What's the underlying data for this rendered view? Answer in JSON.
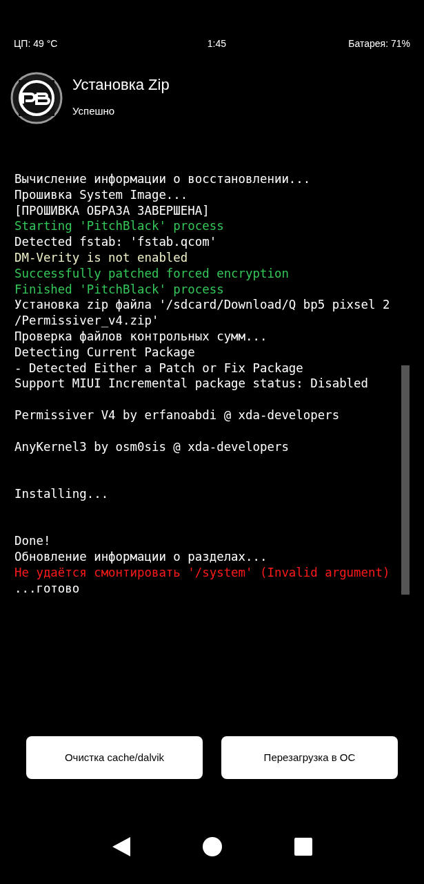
{
  "status_bar": {
    "cpu": "ЦП: 49 °C",
    "time": "1:45",
    "battery": "Батарея: 71%"
  },
  "header": {
    "title": "Установка Zip",
    "subtitle": "Успешно"
  },
  "log": [
    {
      "kind": "normal",
      "text": "Вычисление информации о восстановлении..."
    },
    {
      "kind": "normal",
      "text": "Прошивка System Image..."
    },
    {
      "kind": "normal",
      "text": "[ПРОШИВКА ОБРАЗА ЗАВЕРШЕНА]"
    },
    {
      "kind": "success",
      "text": "Starting 'PitchBlack' process"
    },
    {
      "kind": "normal",
      "text": "Detected fstab: 'fstab.qcom'"
    },
    {
      "kind": "warning",
      "text": "DM-Verity is not enabled"
    },
    {
      "kind": "success",
      "text": "Successfully patched forced encryption"
    },
    {
      "kind": "success",
      "text": "Finished 'PitchBlack' process"
    },
    {
      "kind": "normal",
      "text": "Установка zip файла '/sdcard/Download/Q bp5 pixsel 2"
    },
    {
      "kind": "normal",
      "text": "/Permissiver_v4.zip'"
    },
    {
      "kind": "normal",
      "text": "Проверка файлов контрольных сумм..."
    },
    {
      "kind": "normal",
      "text": "Detecting Current Package"
    },
    {
      "kind": "normal",
      "text": "- Detected Either a Patch or Fix Package"
    },
    {
      "kind": "normal",
      "text": "Support MIUI Incremental package status: Disabled"
    },
    {
      "kind": "spacer"
    },
    {
      "kind": "normal",
      "text": "Permissiver V4 by erfanoabdi @ xda-developers"
    },
    {
      "kind": "spacer"
    },
    {
      "kind": "normal",
      "text": "AnyKernel3 by osm0sis @ xda-developers"
    },
    {
      "kind": "spacer"
    },
    {
      "kind": "spacer"
    },
    {
      "kind": "normal",
      "text": "Installing..."
    },
    {
      "kind": "spacer"
    },
    {
      "kind": "spacer"
    },
    {
      "kind": "normal",
      "text": "Done!"
    },
    {
      "kind": "normal",
      "text": "Обновление информации о разделах..."
    },
    {
      "kind": "error",
      "text": "Не удаётся смонтировать '/system' (Invalid argument)"
    },
    {
      "kind": "normal",
      "text": "...готово"
    }
  ],
  "buttons": [
    "Очистка cache/dalvik",
    "Перезагрузка в ОС"
  ]
}
